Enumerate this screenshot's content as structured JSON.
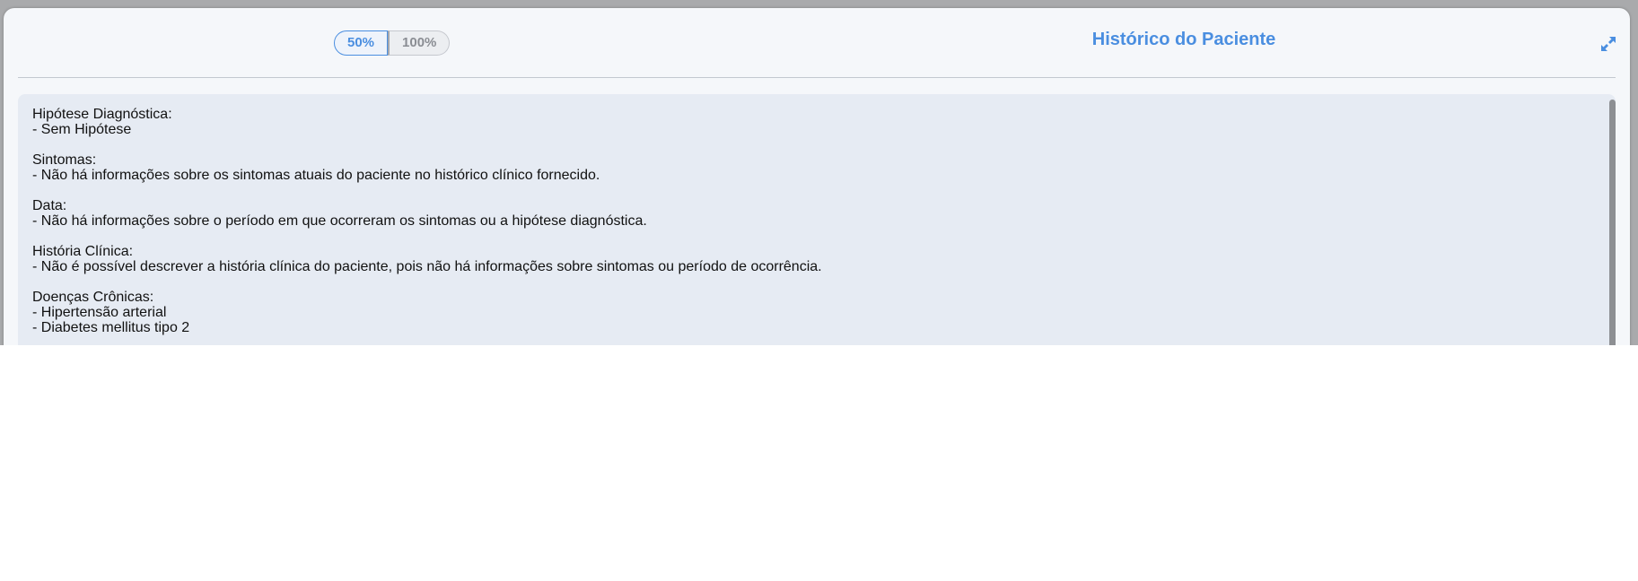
{
  "zoom": {
    "options": [
      "50%",
      "100%"
    ],
    "selected": "50%"
  },
  "header": {
    "title": "Histórico do Paciente",
    "expand_icon": "expand-icon"
  },
  "colors": {
    "accent": "#4a8ee0",
    "content_bg": "#e6ebf3"
  },
  "sections": [
    {
      "heading": "Hipótese Diagnóstica:",
      "lines": [
        "- Sem Hipótese"
      ]
    },
    {
      "heading": "Sintomas:",
      "lines": [
        "- Não há informações sobre os sintomas atuais do paciente no histórico clínico fornecido."
      ]
    },
    {
      "heading": "Data:",
      "lines": [
        "- Não há informações sobre o período em que ocorreram os sintomas ou a hipótese diagnóstica."
      ]
    },
    {
      "heading": "História Clínica:",
      "lines": [
        "- Não é possível descrever a história clínica do paciente, pois não há informações sobre sintomas ou período de ocorrência."
      ]
    },
    {
      "heading": "Doenças Crônicas:",
      "lines": [
        "- Hipertensão arterial",
        "- Diabetes mellitus tipo 2"
      ]
    }
  ]
}
